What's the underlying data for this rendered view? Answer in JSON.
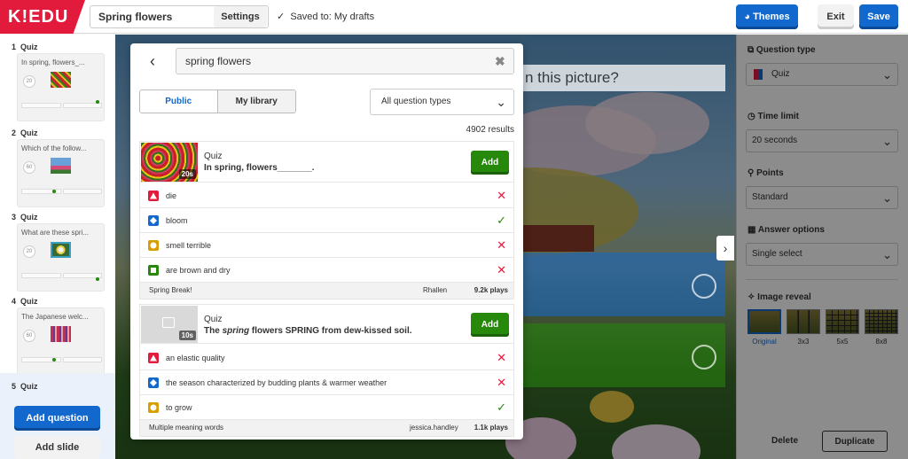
{
  "header": {
    "logo": "K!EDU",
    "title": "Spring flowers",
    "settings_label": "Settings",
    "saved_text": "Saved to: My drafts",
    "themes_label": "Themes",
    "exit_label": "Exit",
    "save_label": "Save"
  },
  "sidebar": {
    "slides": [
      {
        "num": "1",
        "type": "Quiz",
        "text": "In spring, flowers_...",
        "time": "20"
      },
      {
        "num": "2",
        "type": "Quiz",
        "text": "Which of the follow...",
        "time": "60"
      },
      {
        "num": "3",
        "type": "Quiz",
        "text": "What are these spri...",
        "time": "20"
      },
      {
        "num": "4",
        "type": "Quiz",
        "text": "The Japanese welc...",
        "time": "60"
      },
      {
        "num": "5",
        "type": "Quiz"
      }
    ],
    "add_question_label": "Add question",
    "add_slide_label": "Add slide"
  },
  "canvas": {
    "question_fragment": "n this picture?"
  },
  "right_panel": {
    "question_type_label": "Question type",
    "question_type_value": "Quiz",
    "time_limit_label": "Time limit",
    "time_limit_value": "20 seconds",
    "points_label": "Points",
    "points_value": "Standard",
    "answer_options_label": "Answer options",
    "answer_options_value": "Single select",
    "image_reveal_label": "Image reveal",
    "reveal_options": [
      "Original",
      "3x3",
      "5x5",
      "8x8"
    ],
    "delete_label": "Delete",
    "duplicate_label": "Duplicate"
  },
  "modal": {
    "search_value": "spring flowers",
    "tab_public": "Public",
    "tab_library": "My library",
    "filter_value": "All question types",
    "results_count": "4902 results",
    "results": [
      {
        "type": "Quiz",
        "title": "In spring, flowers_______.",
        "time": "20s",
        "add_label": "Add",
        "answers": [
          {
            "shape": "triangle",
            "text": "die",
            "correct": false
          },
          {
            "shape": "diamond",
            "text": "bloom",
            "correct": true
          },
          {
            "shape": "circle",
            "text": "smell terrible",
            "correct": false
          },
          {
            "shape": "square",
            "text": "are brown and dry",
            "correct": false
          }
        ],
        "kahoot": "Spring Break!",
        "author": "Rhallen",
        "plays": "9.2k plays"
      },
      {
        "type": "Quiz",
        "title_pre": "The ",
        "title_em": "spring",
        "title_post": " flowers SPRING from dew-kissed soil.",
        "time": "10s",
        "add_label": "Add",
        "answers": [
          {
            "shape": "triangle",
            "text": "an elastic quality",
            "correct": false
          },
          {
            "shape": "diamond",
            "text": "the season characterized by budding plants & warmer weather",
            "correct": false
          },
          {
            "shape": "circle",
            "text": "to grow",
            "correct": true
          }
        ],
        "kahoot": "Multiple meaning words",
        "author": "jessica.handley",
        "plays": "1.1k plays"
      }
    ]
  },
  "colors": {
    "brand": "#e21b3c",
    "blue": "#1368ce",
    "green": "#26890c",
    "yellow": "#d89e00",
    "red": "#e21b3c",
    "wrong": "#e21b3c",
    "correct": "#26890c"
  },
  "icons": {
    "back": "arrow-left-icon",
    "clear": "close-icon",
    "chevron": "chevron-down-icon",
    "check": "check-icon",
    "wrong": "cross-icon"
  }
}
